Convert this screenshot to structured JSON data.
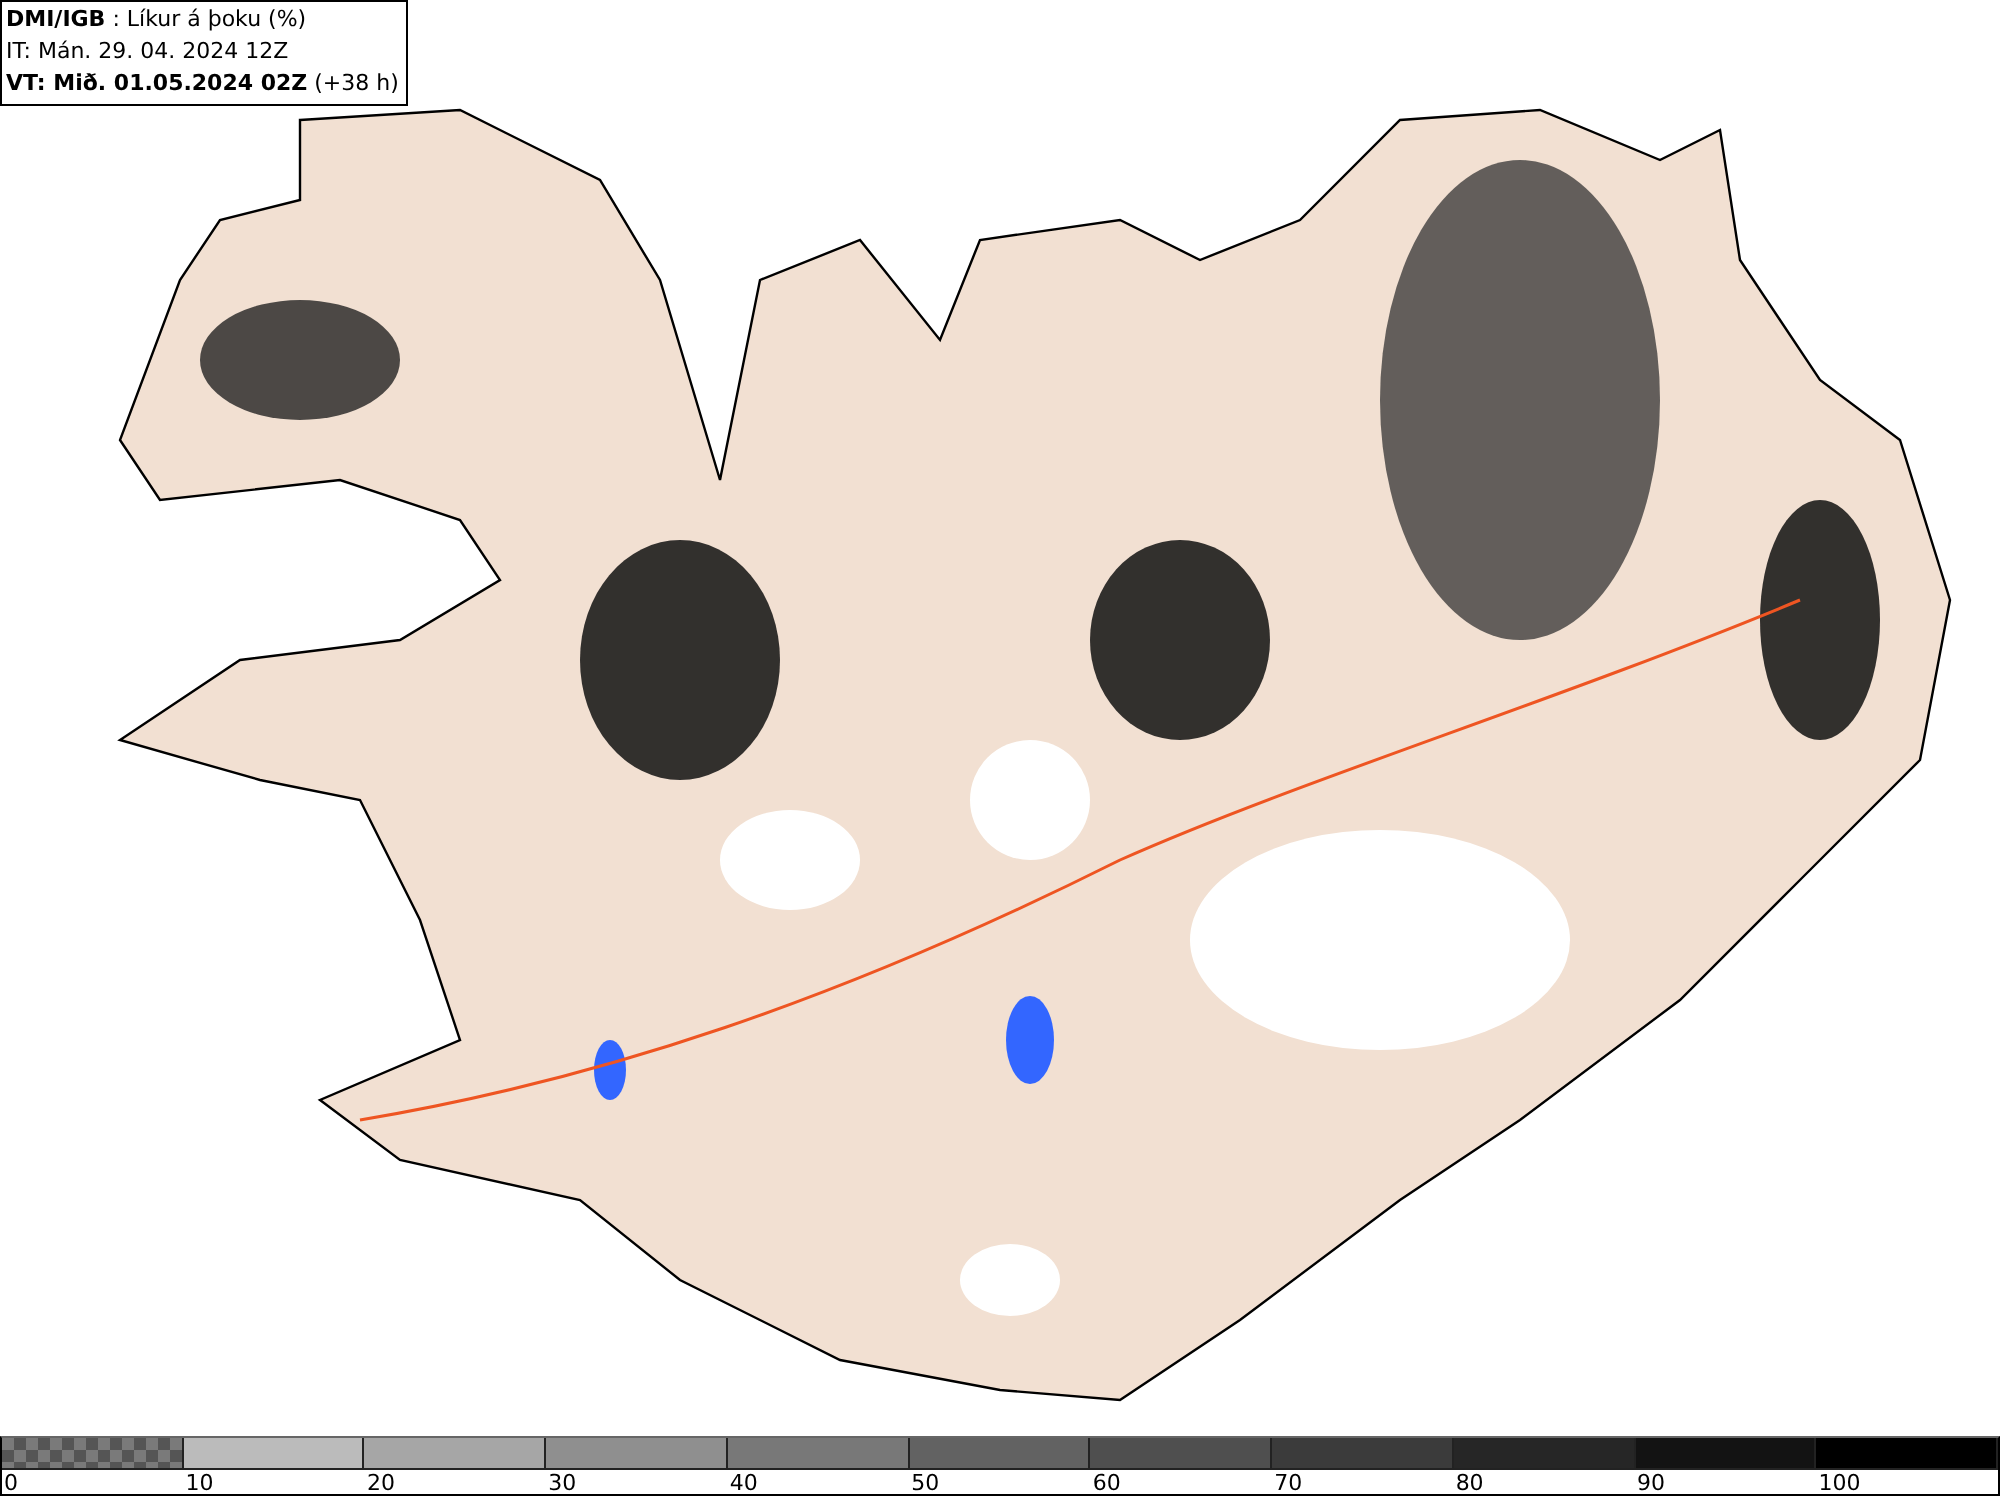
{
  "header": {
    "lines": [
      "**DMI/IGB** : Líkur á þoku (%)",
      "IT: Mán. 29. 04. 2024 12Z",
      "**VT: Mið. 01.05.2024 02Z** (+38 h)"
    ]
  },
  "legend": [
    {
      "kind": "checker",
      "color": "#7a7a7a",
      "label": "0"
    },
    {
      "kind": "solid",
      "color": "#bbbbbb",
      "label": "10"
    },
    {
      "kind": "solid",
      "color": "#a6a6a6",
      "label": "20"
    },
    {
      "kind": "solid",
      "color": "#8f8f8f",
      "label": "30"
    },
    {
      "kind": "solid",
      "color": "#787878",
      "label": "40"
    },
    {
      "kind": "solid",
      "color": "#626262",
      "label": "50"
    },
    {
      "kind": "solid",
      "color": "#4f4f4f",
      "label": "60"
    },
    {
      "kind": "solid",
      "color": "#3b3b3b",
      "label": "70"
    },
    {
      "kind": "solid",
      "color": "#262626",
      "label": "80"
    },
    {
      "kind": "solid",
      "color": "#131313",
      "label": "90"
    },
    {
      "kind": "solid",
      "color": "#000000",
      "label": "100"
    }
  ]
}
